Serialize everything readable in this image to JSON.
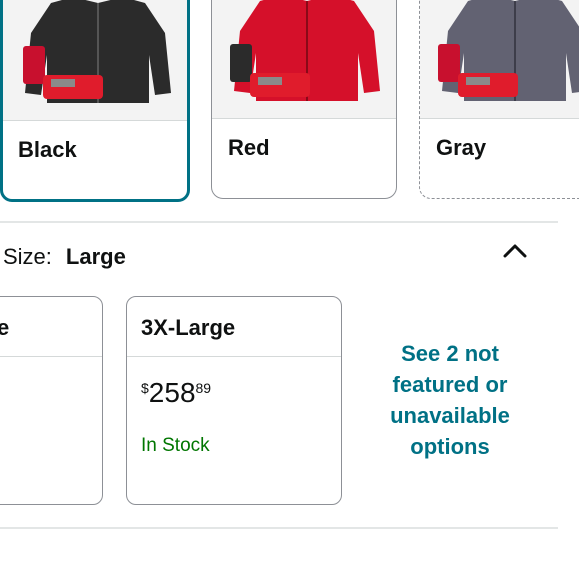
{
  "colors": [
    {
      "label": "Black",
      "selected": true,
      "jacket_color": "#2b2b2b",
      "status": "selected"
    },
    {
      "label": "Red",
      "selected": false,
      "jacket_color": "#d5102a",
      "status": "available"
    },
    {
      "label": "Gray",
      "selected": false,
      "jacket_color": "#626272",
      "status": "unavailable"
    }
  ],
  "size_section": {
    "key_label": "Size:",
    "selected_value": "Large",
    "toggle_icon": "chevron-up-icon"
  },
  "size_options": [
    {
      "label": "e",
      "partial": true
    },
    {
      "label": "3X-Large",
      "price_symbol": "$",
      "price_whole": "258",
      "price_fraction": "89",
      "availability": "In Stock"
    }
  ],
  "see_more_link": "See 2 not featured or unavailable options",
  "theme": {
    "accent": "#007185",
    "in_stock": "#007600",
    "border": "#8d9096",
    "text": "#0f1111"
  }
}
